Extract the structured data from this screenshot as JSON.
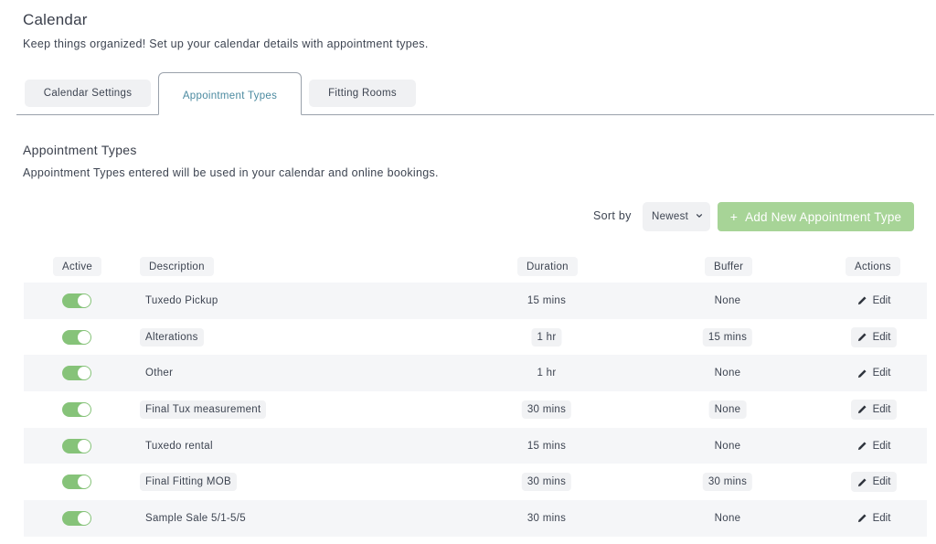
{
  "header": {
    "title": "Calendar",
    "subtitle": "Keep things organized! Set up your calendar details with appointment types."
  },
  "tabs": [
    {
      "label": "Calendar Settings",
      "active": false
    },
    {
      "label": "Appointment Types",
      "active": true
    },
    {
      "label": "Fitting Rooms",
      "active": false
    }
  ],
  "section": {
    "title": "Appointment Types",
    "subtitle": "Appointment Types entered will be used in your calendar and online bookings."
  },
  "toolbar": {
    "sort_label": "Sort by",
    "sort_value": "Newest",
    "add_label": "Add New Appointment Type",
    "add_icon": "plus-icon",
    "add_color": "#a7d497"
  },
  "table": {
    "columns": [
      "Active",
      "Description",
      "Duration",
      "Buffer",
      "Actions"
    ],
    "edit_label": "Edit",
    "toggle_color": "#86c379",
    "rows": [
      {
        "active": true,
        "description": "Tuxedo Pickup",
        "duration": "15 mins",
        "buffer": "None"
      },
      {
        "active": true,
        "description": "Alterations",
        "duration": "1 hr",
        "buffer": "15 mins"
      },
      {
        "active": true,
        "description": "Other",
        "duration": "1 hr",
        "buffer": "None"
      },
      {
        "active": true,
        "description": "Final Tux measurement",
        "duration": "30 mins",
        "buffer": "None"
      },
      {
        "active": true,
        "description": "Tuxedo rental",
        "duration": "15 mins",
        "buffer": "None"
      },
      {
        "active": true,
        "description": "Final Fitting MOB",
        "duration": "30 mins",
        "buffer": "30 mins"
      },
      {
        "active": true,
        "description": "Sample Sale 5/1-5/5",
        "duration": "30 mins",
        "buffer": "None"
      }
    ]
  }
}
